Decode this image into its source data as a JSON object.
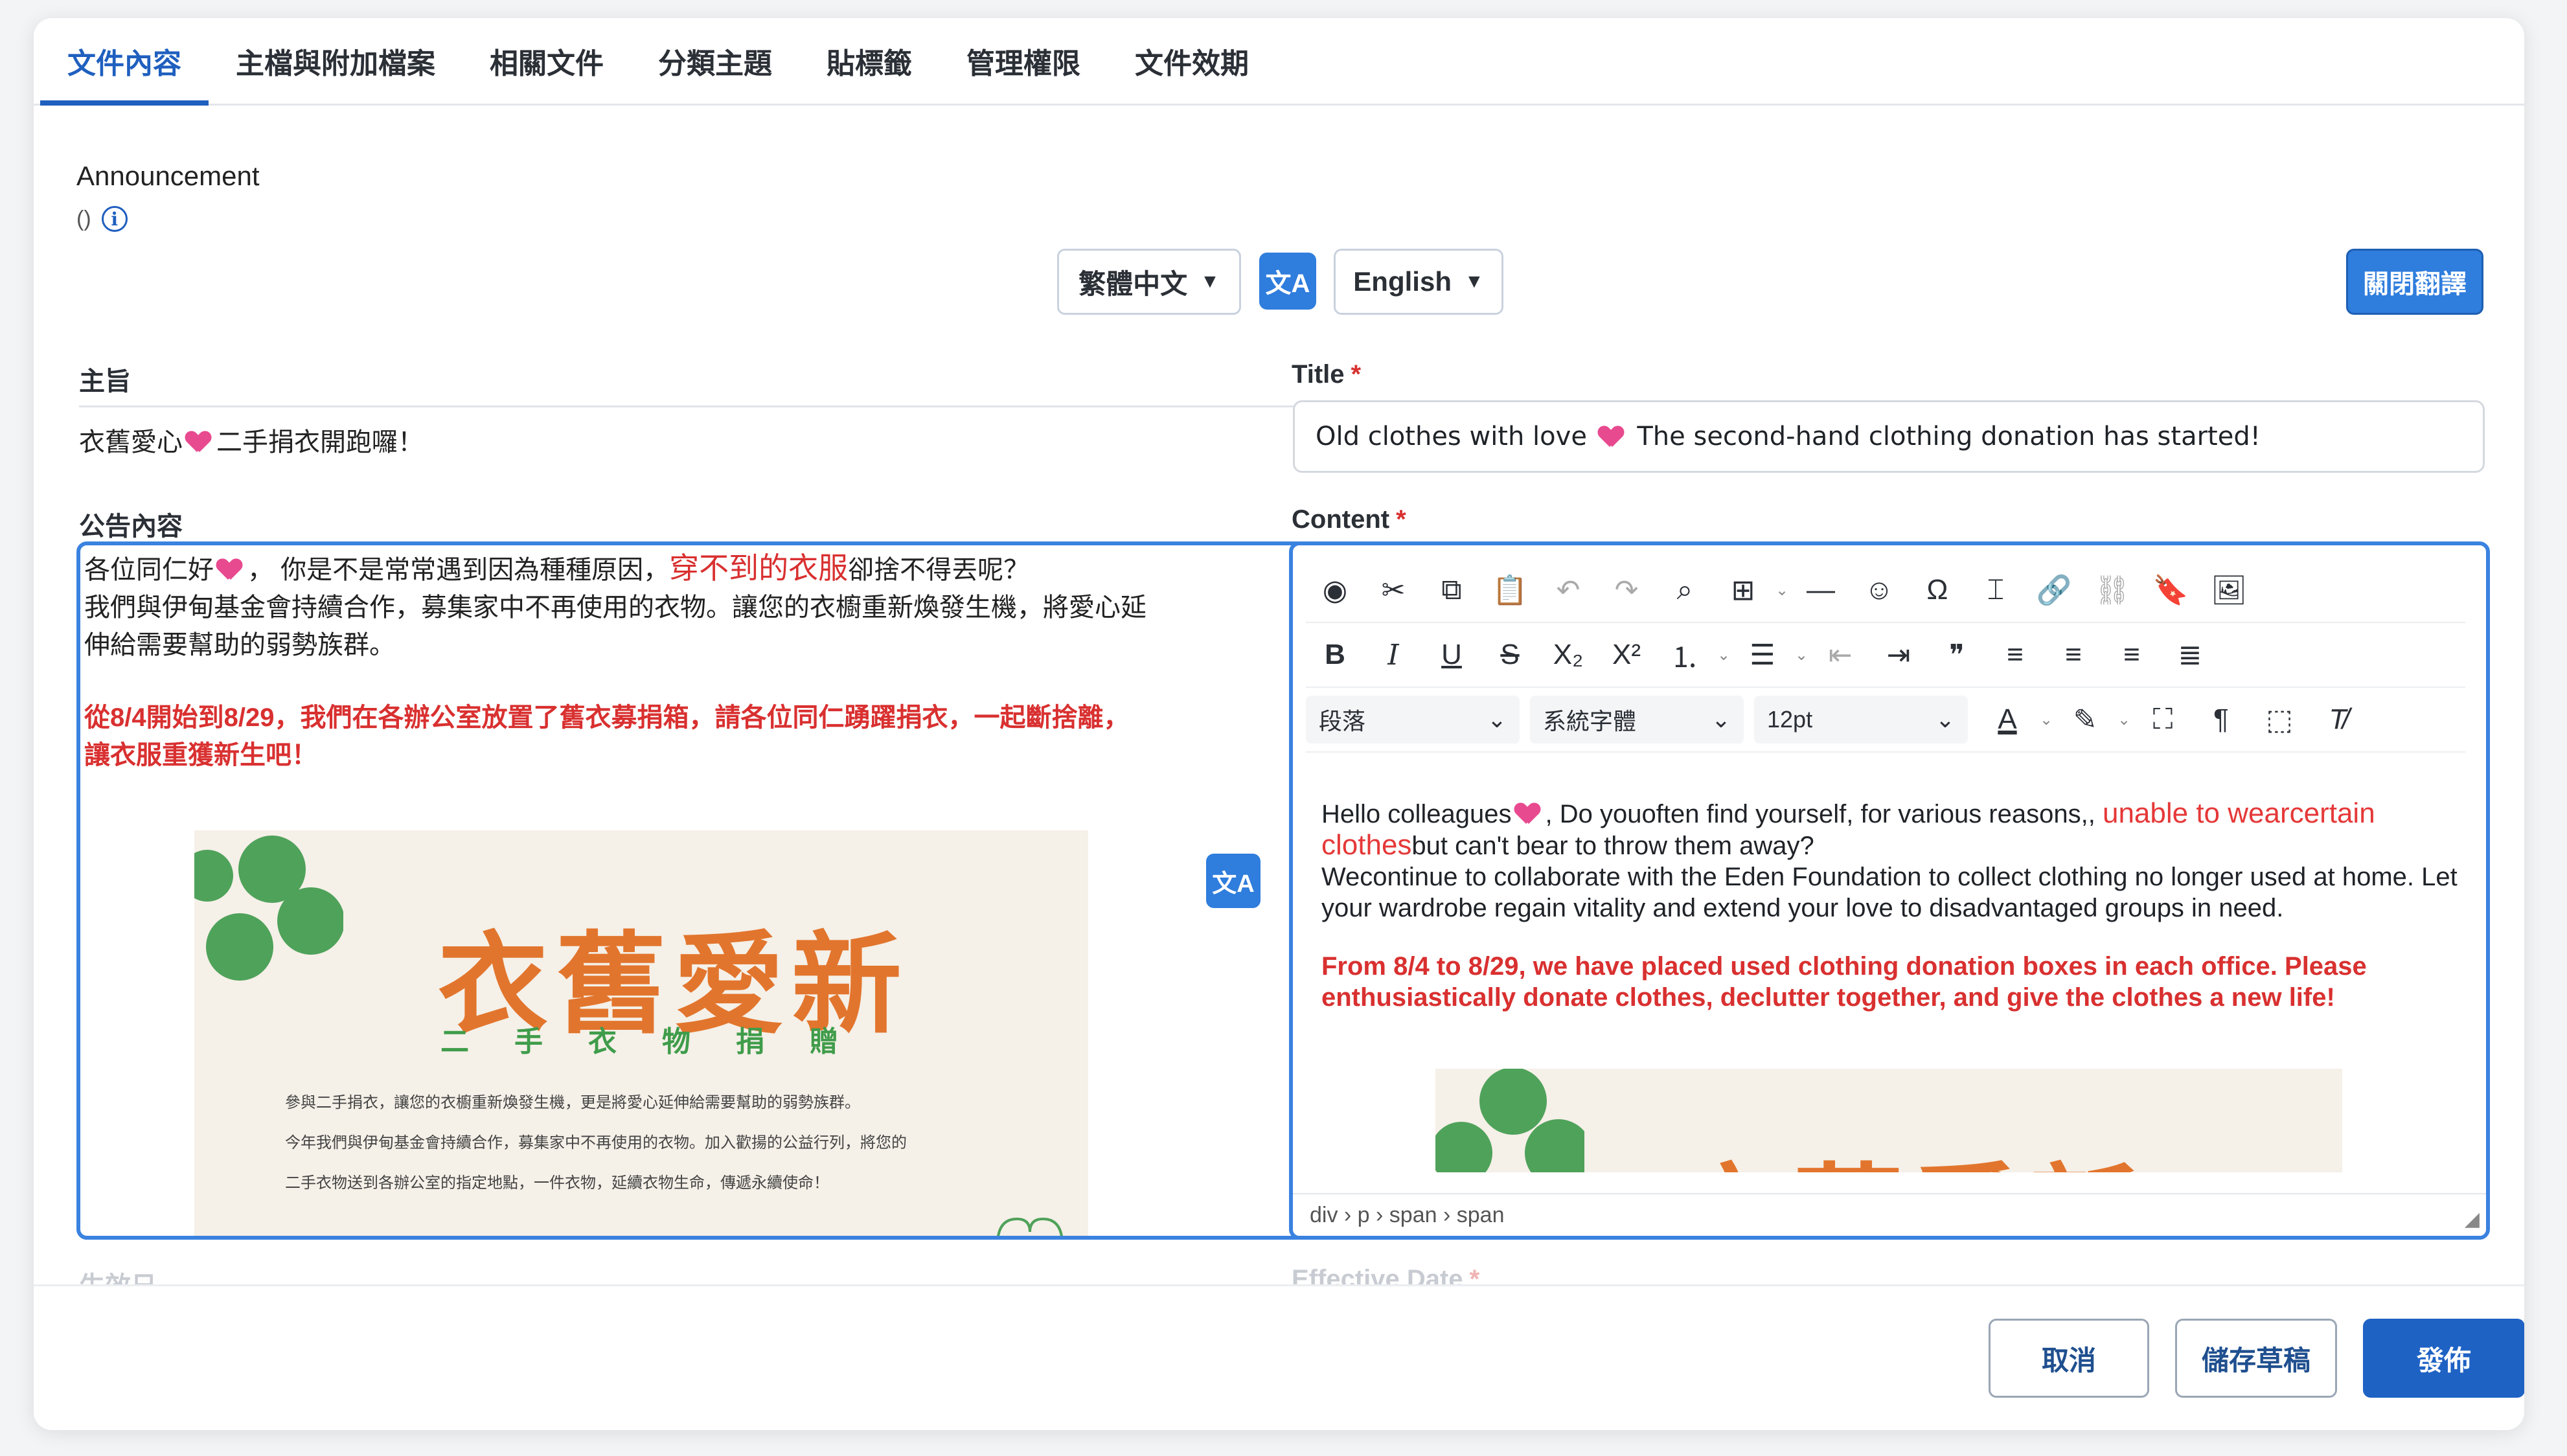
{
  "tabs": [
    {
      "label": "文件內容",
      "active": true
    },
    {
      "label": "主檔與附加檔案"
    },
    {
      "label": "相關文件"
    },
    {
      "label": "分類主題"
    },
    {
      "label": "貼標籤"
    },
    {
      "label": "管理權限"
    },
    {
      "label": "文件效期"
    }
  ],
  "section": {
    "title": "Announcement",
    "subtitle": "()"
  },
  "languages": {
    "source": "繁體中文",
    "target": "English",
    "close_translate": "關閉翻譯"
  },
  "left": {
    "subject_label": "主旨",
    "subject_value_before": "衣舊愛心",
    "subject_value_after": "二手捐衣開跑囉！",
    "content_label": "公告內容",
    "line1_a": "各位同仁好",
    "line1_b": "，  你是不是常常遇到因為種種原因，",
    "line1_red": "穿不到的衣服",
    "line1_c": "卻捨不得丟呢？",
    "line2": "我們與伊甸基金會持續合作，募集家中不再使用的衣物。讓您的衣櫥重新煥發生機，將愛心延",
    "line3": "伸給需要幫助的弱勢族群。",
    "red1": "從8/4開始到8/29，我們在各辦公室放置了舊衣募捐箱，請各位同仁踴躍捐衣，一起斷捨離，",
    "red2": "讓衣服重獲新生吧！",
    "poster_title": "衣舊愛新",
    "poster_sub": "二手衣物捐贈",
    "poster_lines": [
      "參與二手捐衣，讓您的衣櫥重新煥發生機，更是將愛心延伸給需要幫助的弱勢族群。",
      "今年我們與伊甸基金會持續合作，募集家中不再使用的衣物。加入歡揚的公益行列，將您的",
      "二手衣物送到各辦公室的指定地點，一件衣物，延續衣物生命，傳遞永續使命！"
    ],
    "effective_label": "生效日"
  },
  "right": {
    "title_label": "Title",
    "title_value_before": "Old clothes with love",
    "title_value_after": "The second-hand clothing donation has started!",
    "content_label": "Content",
    "toolbar": {
      "paragraph_select": "段落",
      "font_select": "系統字體",
      "size_select": "12pt"
    },
    "body": {
      "p1_a": "Hello colleagues",
      "p1_b": ", Do youoften find yourself, for various reasons,,",
      "p1_red": "unable to wearcertain clothes",
      "p1_c": "but can't bear to throw them away?",
      "p2": "Wecontinue to collaborate with the Eden Foundation to collect clothing no longer used at home. Let your wardrobe regain vitality and extend your love to disadvantaged groups in need.",
      "p3": "From 8/4 to 8/29, we have placed used clothing donation boxes in each office. Please enthusiastically donate clothes, declutter together, and give the clothes a new life!"
    },
    "poster_title": "衣舊愛新",
    "statusbar": "div › p › span › span",
    "effective_label": "Effective Date"
  },
  "footer": {
    "cancel": "取消",
    "save_draft": "儲存草稿",
    "publish": "發佈"
  },
  "colors": {
    "accent": "#1f5fbf",
    "button": "#2f7ddd",
    "red": "#d93030",
    "poster_orange": "#e2752d",
    "poster_green": "#3f9c4a"
  }
}
